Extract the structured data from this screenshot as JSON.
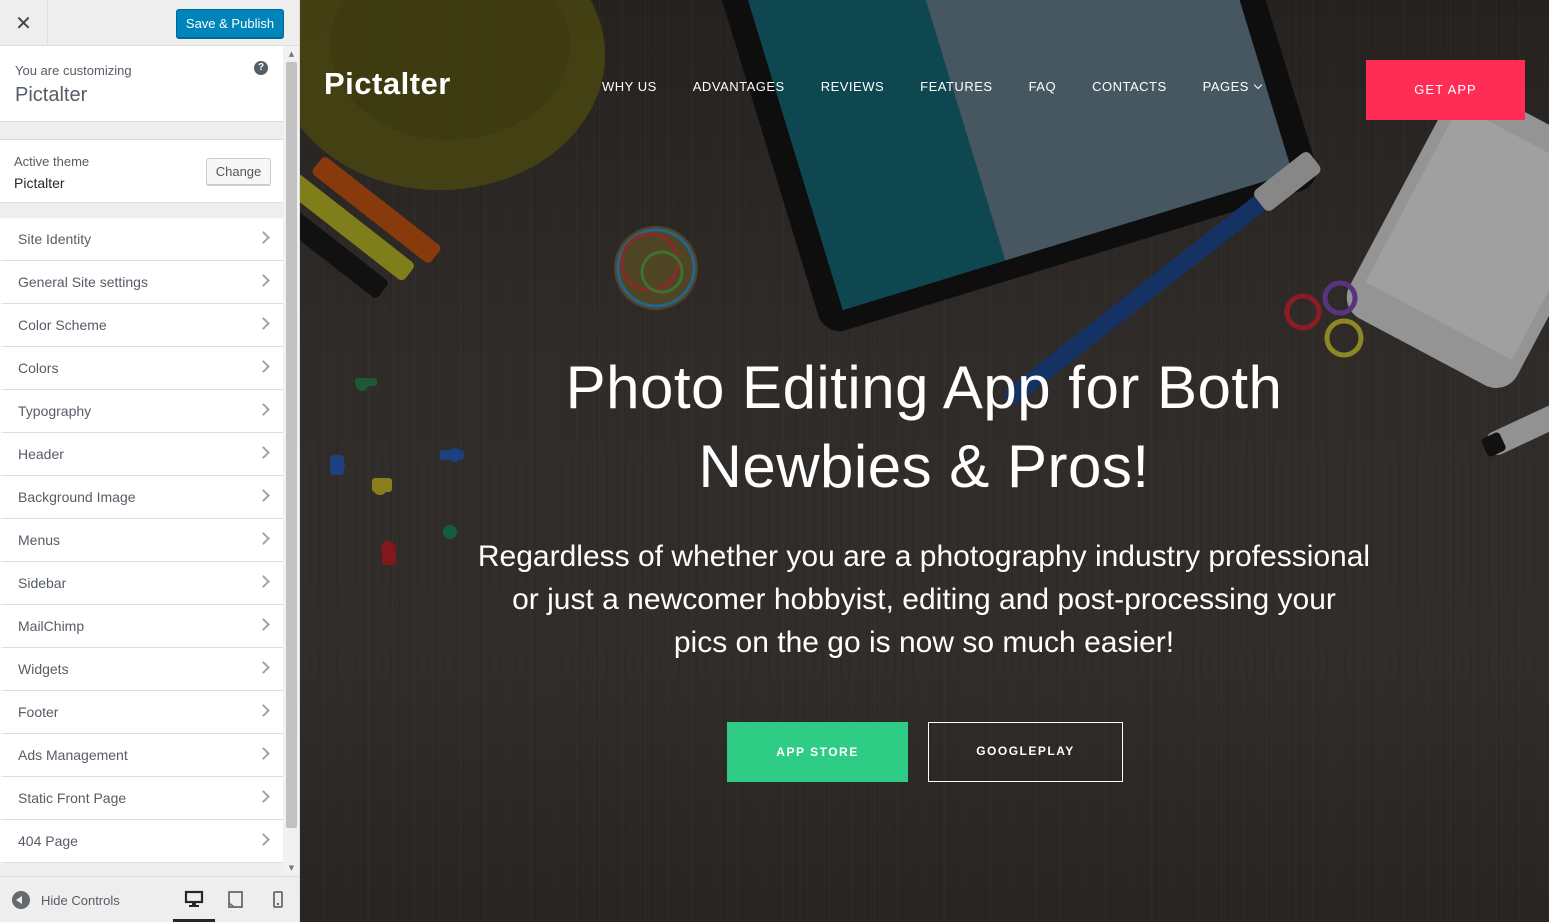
{
  "customizer": {
    "close_icon": "close-icon",
    "save_label": "Save & Publish",
    "customizing_label": "You are customizing",
    "site_title": "Pictalter",
    "help_icon": "?",
    "active_theme_label": "Active theme",
    "active_theme_name": "Pictalter",
    "change_label": "Change",
    "sections": [
      {
        "label": "Site Identity"
      },
      {
        "label": "General Site settings"
      },
      {
        "label": "Color Scheme"
      },
      {
        "label": "Colors"
      },
      {
        "label": "Typography"
      },
      {
        "label": "Header"
      },
      {
        "label": "Background Image"
      },
      {
        "label": "Menus"
      },
      {
        "label": "Sidebar"
      },
      {
        "label": "MailChimp"
      },
      {
        "label": "Widgets"
      },
      {
        "label": "Footer"
      },
      {
        "label": "Ads Management"
      },
      {
        "label": "Static Front Page"
      },
      {
        "label": "404 Page"
      }
    ],
    "hide_controls_label": "Hide Controls",
    "devices": [
      "desktop",
      "tablet",
      "mobile"
    ],
    "active_device": "desktop",
    "colors": {
      "primary_button": "#0085ba"
    }
  },
  "preview": {
    "brand": "Pictalter",
    "nav": [
      {
        "label": "WHY US"
      },
      {
        "label": "ADVANTAGES"
      },
      {
        "label": "REVIEWS"
      },
      {
        "label": "FEATURES"
      },
      {
        "label": "FAQ"
      },
      {
        "label": "CONTACTS"
      },
      {
        "label": "PAGES"
      }
    ],
    "get_app_label": "GET APP",
    "hero_title_line1": "Photo Editing App for Both",
    "hero_title_line2": "Newbies & Pros!",
    "hero_sub_line1": "Regardless of whether you are a photography industry professional",
    "hero_sub_line2": "or just a newcomer hobbyist, editing and post-processing your",
    "hero_sub_line3": "pics on the go is now so much easier!",
    "app_store_label": "APP STORE",
    "google_play_label": "GOOGLEPLAY",
    "colors": {
      "get_app": "#ff2d55",
      "app_store": "#2ecc85"
    }
  }
}
